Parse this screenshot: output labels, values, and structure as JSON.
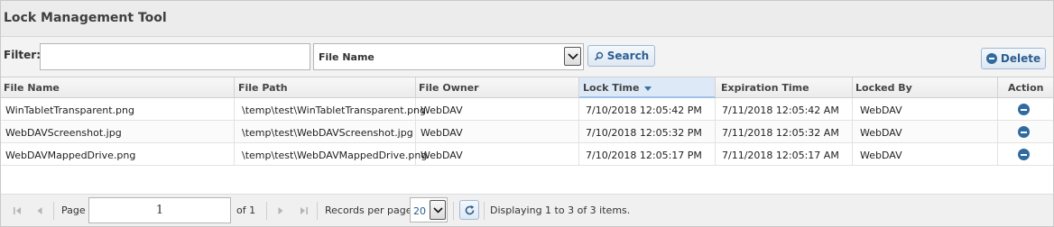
{
  "header": {
    "title": "Lock Management Tool"
  },
  "filter": {
    "label": "Filter:",
    "value": "",
    "field_selected": "File Name",
    "search_label": "Search",
    "delete_label": "Delete"
  },
  "table": {
    "columns": [
      "File Name",
      "File Path",
      "File Owner",
      "Lock Time",
      "Expiration Time",
      "Locked By",
      "Action"
    ],
    "sorted_column": "Lock Time",
    "sort_direction": "descending",
    "rows": [
      {
        "file_name": "WinTabletTransparent.png",
        "file_path": "\\temp\\test\\WinTabletTransparent.png",
        "file_owner": "WebDAV",
        "lock_time": "7/10/2018 12:05:42 PM",
        "expiration_time": "7/11/2018 12:05:42 AM",
        "locked_by": "WebDAV"
      },
      {
        "file_name": "WebDAVScreenshot.jpg",
        "file_path": "\\temp\\test\\WebDAVScreenshot.jpg",
        "file_owner": "WebDAV",
        "lock_time": "7/10/2018 12:05:32 PM",
        "expiration_time": "7/11/2018 12:05:32 AM",
        "locked_by": "WebDAV"
      },
      {
        "file_name": "WebDAVMappedDrive.png",
        "file_path": "\\temp\\test\\WebDAVMappedDrive.png",
        "file_owner": "WebDAV",
        "lock_time": "7/10/2018 12:05:17 PM",
        "expiration_time": "7/11/2018 12:05:17 AM",
        "locked_by": "WebDAV"
      }
    ]
  },
  "pager": {
    "page_label": "Page",
    "page_value": "1",
    "of_label": "of 1",
    "records_label": "Records per page:",
    "records_value": "20",
    "status": "Displaying 1 to 3 of 3 items."
  },
  "colors": {
    "accent": "#2f6aa0",
    "button_border": "#9fb9d6",
    "sorted_header": "#dde9f7"
  }
}
